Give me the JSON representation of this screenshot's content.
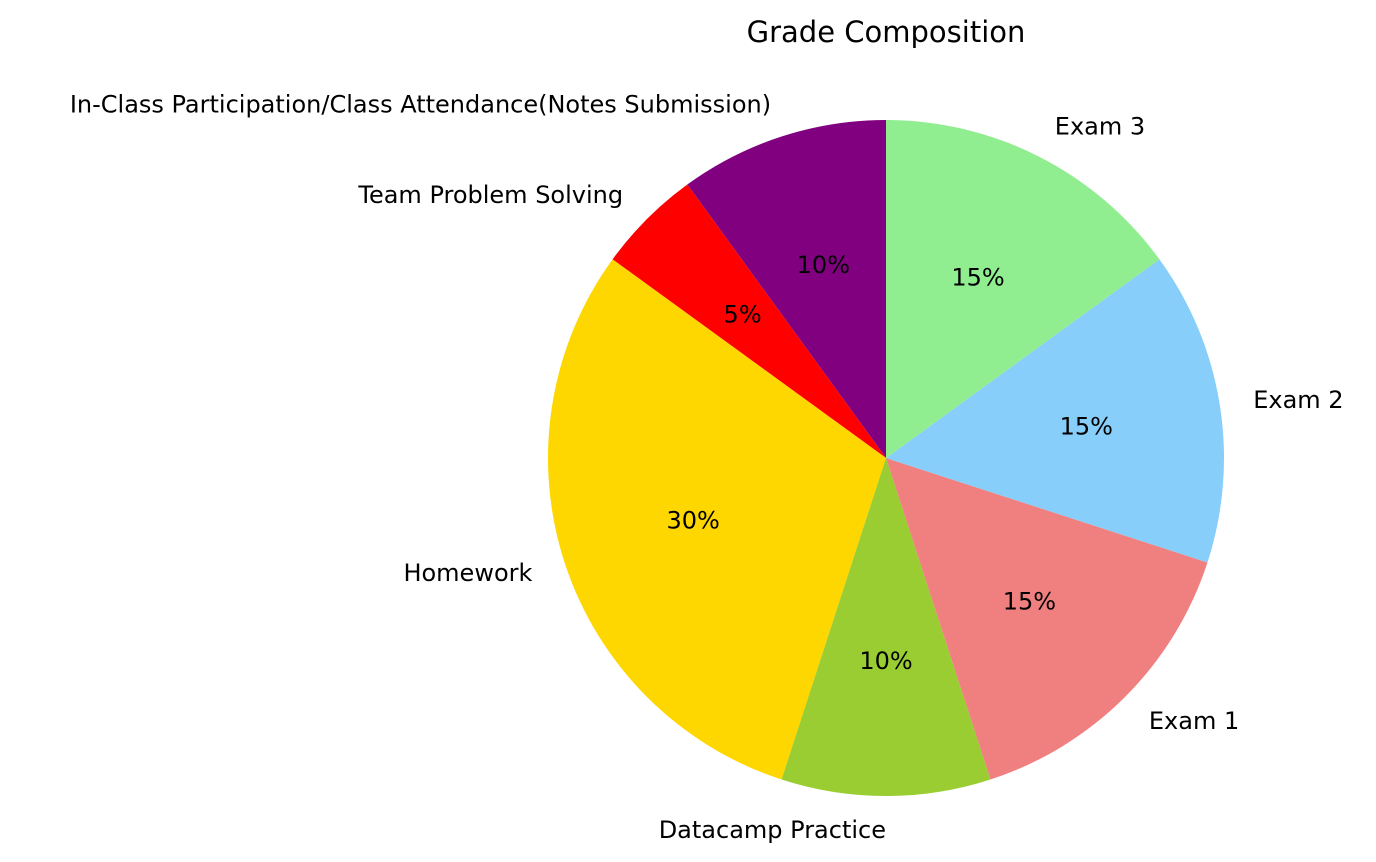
{
  "chart_data": {
    "type": "pie",
    "title": "Grade Composition",
    "start_angle_deg": 90,
    "direction": "counterclockwise",
    "autopct_format": "%.0f%%",
    "slices": [
      {
        "label": "In-Class Participation/Class Attendance(Notes Submission)",
        "value": 10,
        "color": "#800080"
      },
      {
        "label": "Team Problem Solving",
        "value": 5,
        "color": "#ff0000"
      },
      {
        "label": "Homework",
        "value": 30,
        "color": "#ffd700"
      },
      {
        "label": "Datacamp Practice",
        "value": 10,
        "color": "#9acd32"
      },
      {
        "label": "Exam 1",
        "value": 15,
        "color": "#f08080"
      },
      {
        "label": "Exam 2",
        "value": 15,
        "color": "#87cefa"
      },
      {
        "label": "Exam 3",
        "value": 15,
        "color": "#90ee90"
      }
    ]
  }
}
